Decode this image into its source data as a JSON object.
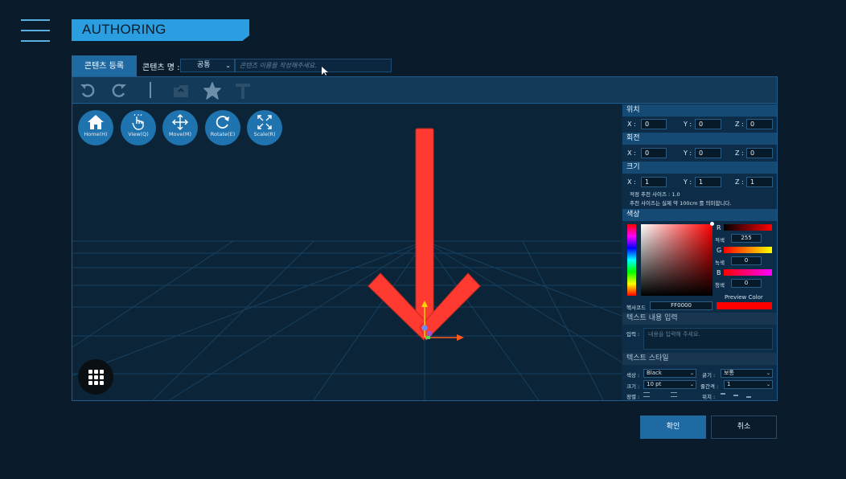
{
  "header": {
    "title": "AUTHORING"
  },
  "content_tab": {
    "label": "콘텐츠 등록"
  },
  "content_name": {
    "label": "콘텐츠 명 :",
    "category_selected": "공통",
    "name_placeholder": "콘텐츠 이름을 작성해주세요."
  },
  "toolbar": {
    "icons": [
      "undo-icon",
      "redo-icon",
      "separator",
      "folder-icon",
      "shape-icon",
      "text-icon"
    ]
  },
  "view_controls": [
    {
      "label": "Home(H)",
      "icon": "home-icon"
    },
    {
      "label": "View(Q)",
      "icon": "hand-icon"
    },
    {
      "label": "Move(M)",
      "icon": "move-icon"
    },
    {
      "label": "Rotate(E)",
      "icon": "rotate-icon"
    },
    {
      "label": "Scale(R)",
      "icon": "scale-icon"
    }
  ],
  "panel": {
    "position": {
      "title": "위치",
      "x_label": "X :",
      "y_label": "Y :",
      "z_label": "Z :",
      "x": "0",
      "y": "0",
      "z": "0"
    },
    "rotation": {
      "title": "회전",
      "x_label": "X :",
      "y_label": "Y :",
      "z_label": "Z :",
      "x": "0",
      "y": "0",
      "z": "0"
    },
    "size": {
      "title": "크기",
      "x_label": "X :",
      "y_label": "Y :",
      "z_label": "Z :",
      "x": "1",
      "y": "1",
      "z": "1",
      "note1": "적정 추천 사이즈 : 1.0",
      "note2": "추천 사이즈는 실제 약 100cm 를 의미합니다."
    },
    "color": {
      "title": "색상",
      "r_label": "R",
      "r_name": "적색",
      "r_value": "255",
      "g_label": "G",
      "g_name": "녹색",
      "g_value": "0",
      "b_label": "B",
      "b_name": "청색",
      "b_value": "0",
      "preview_label": "Preview Color",
      "hex_label": "헥사코드",
      "hex_value": "FF0000",
      "selected_color": "#ff0000"
    },
    "text_input": {
      "title": "텍스트 내용 입력",
      "label": "입력 :",
      "placeholder": "내용을 입력해 주세요."
    },
    "text_style": {
      "title": "텍스트 스타일",
      "color_label": "색상 :",
      "color_value": "Black",
      "weight_label": "굵기 :",
      "weight_value": "보통",
      "size_label": "크기 :",
      "size_value": "10 pt",
      "line_label": "줄간격 :",
      "line_value": "1",
      "align_label": "정렬 :",
      "pos_label": "위치 :"
    }
  },
  "footer": {
    "confirm": "확인",
    "cancel": "취소"
  }
}
